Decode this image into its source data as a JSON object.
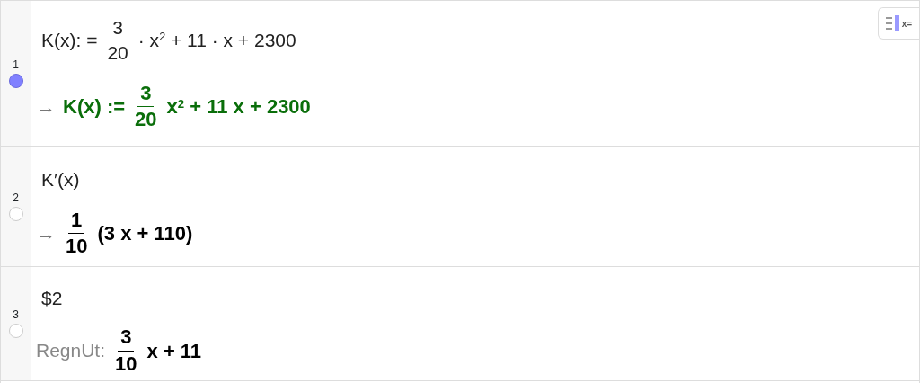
{
  "toggle": {
    "label": "x="
  },
  "rows": [
    {
      "number": "1",
      "selected": true,
      "input": [
        {
          "kind": "text",
          "text": "K(x): ="
        },
        {
          "kind": "frac",
          "num": "3",
          "den": "20"
        },
        {
          "kind": "text",
          "text": "· x$^{2}$ + 11 · x + 2300"
        }
      ],
      "output": {
        "prefix": "→",
        "color": "#0a6e0a",
        "tokens": [
          {
            "kind": "text",
            "text": "K(x) :="
          },
          {
            "kind": "frac",
            "num": "3",
            "den": "20"
          },
          {
            "kind": "text",
            "text": "x$^{2}$ + 11 x + 2300"
          }
        ]
      }
    },
    {
      "number": "2",
      "selected": false,
      "input": [
        {
          "kind": "text",
          "text": "K′(x)"
        }
      ],
      "output": {
        "prefix": "→",
        "color": "#000000",
        "tokens": [
          {
            "kind": "frac",
            "num": "1",
            "den": "10"
          },
          {
            "kind": "text",
            "text": "(3 x + 110)"
          }
        ]
      }
    },
    {
      "number": "3",
      "selected": false,
      "input": [
        {
          "kind": "text",
          "text": "$2"
        }
      ],
      "output": {
        "prefix": "RegnUt:",
        "color": "#000000",
        "tokens": [
          {
            "kind": "frac",
            "num": "3",
            "den": "10"
          },
          {
            "kind": "text",
            "text": "x + 11"
          }
        ]
      }
    }
  ]
}
